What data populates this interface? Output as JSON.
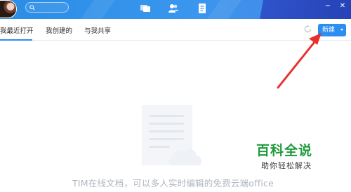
{
  "tabs": [
    {
      "label": "我最近打开",
      "active": true
    },
    {
      "label": "我创建的",
      "active": false
    },
    {
      "label": "与我共享",
      "active": false
    }
  ],
  "toolbar": {
    "new_label": "新建"
  },
  "empty_state": {
    "text": "TIM在线文档，可以多人实时编辑的免费云端office"
  },
  "watermark": {
    "title": "百科全说",
    "subtitle": "助你轻松解决"
  },
  "icons": {
    "search": "search-icon",
    "chat": "chat-icon",
    "contacts": "contacts-icon",
    "documents": "document-icon",
    "minimize": "minimize-icon",
    "close": "close-icon",
    "refresh": "refresh-icon",
    "dropdown": "chevron-down-icon"
  },
  "colors": {
    "accent": "#2c8ef0",
    "topbar": "#3a96ee",
    "annotation_arrow": "#e8302b",
    "watermark_green": "#1f9a3d"
  }
}
